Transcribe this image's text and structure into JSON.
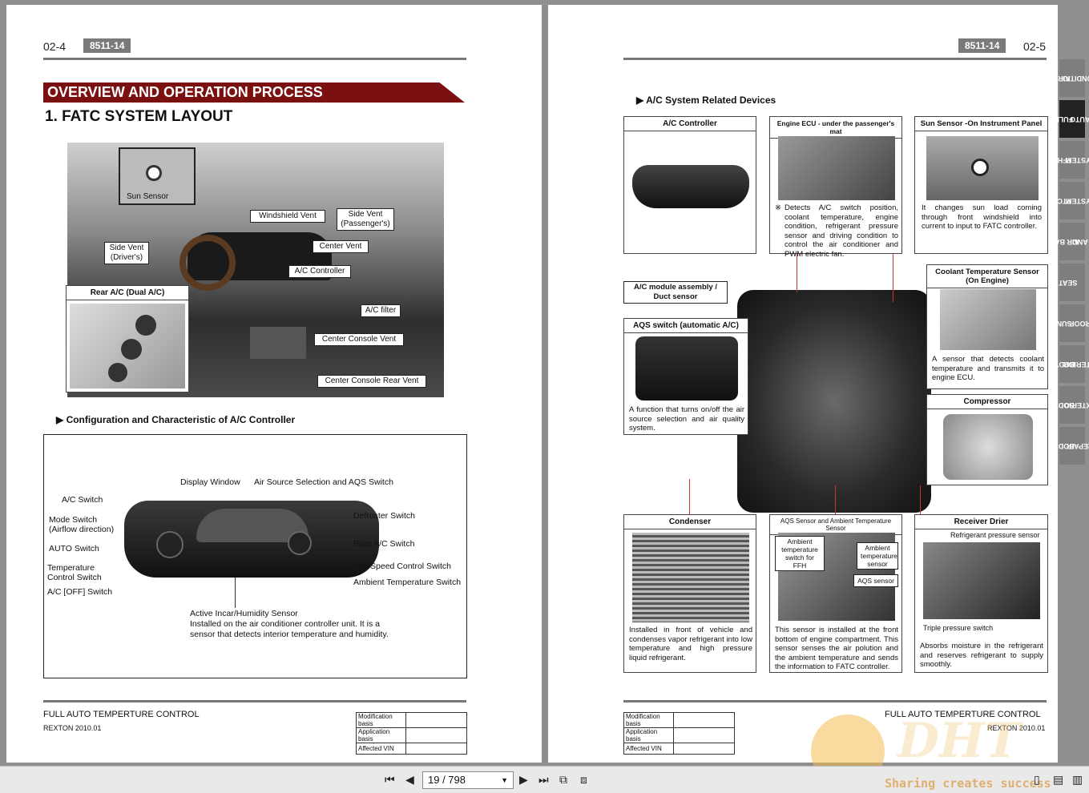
{
  "left": {
    "page_num": "02-4",
    "code": "8511-14",
    "section_title": "OVERVIEW AND OPERATION PROCESS",
    "heading": "1. FATC SYSTEM LAYOUT",
    "layout_callouts": {
      "sun_sensor": "Sun Sensor",
      "windshield_vent": "Windshield Vent",
      "side_vent_passenger_1": "Side Vent",
      "side_vent_passenger_2": "(Passenger's)",
      "side_vent_driver_1": "Side Vent",
      "side_vent_driver_2": "(Driver's)",
      "center_vent": "Center Vent",
      "ac_controller": "A/C Controller",
      "ac_filter": "A/C filter",
      "center_console_vent": "Center Console Vent",
      "center_console_rear_vent": "Center Console Rear Vent",
      "rear_ac": "Rear A/C (Dual A/C)"
    },
    "config_heading": "Configuration and Characteristic of A/C Controller",
    "controller_labels": {
      "display_window": "Display Window",
      "air_source": "Air Source Selection and AQS Switch",
      "ac_switch": "A/C Switch",
      "mode_switch_1": "Mode Switch",
      "mode_switch_2": "(Airflow direction)",
      "auto_switch": "AUTO Switch",
      "temp_1": "Temperature",
      "temp_2": "Control Switch",
      "ac_off": "A/C [OFF] Switch",
      "defroster": "Defroster Switch",
      "rear_ac": "Rear A/C Switch",
      "fan_speed": "Fan Speed Control Switch",
      "ambient_temp": "Ambient Temperature Switch",
      "incar_title": "Active Incar/Humidity Sensor",
      "incar_desc_1": "Installed on the air conditioner controller unit. It is a",
      "incar_desc_2": "sensor that detects interior temperature and humidity."
    },
    "footer_title": "FULL AUTO TEMPERTURE CONTROL",
    "footer_sub": "REXTON 2010.01",
    "footer_table": [
      "Modification basis",
      "Application basis",
      "Affected VIN"
    ]
  },
  "right": {
    "page_num": "02-5",
    "code": "8511-14",
    "devices_heading": "A/C System Related Devices",
    "ac_controller": "A/C Controller",
    "engine_ecu": "Engine ECU - under the passenger's mat",
    "engine_ecu_mark": "※",
    "engine_ecu_desc": "Detects A/C switch position, coolant temperature, engine condition, refrigerant pressure sensor and driving condition to control the air conditioner and PWM electric fan.",
    "sun_sensor": "Sun Sensor -On Instrument Panel",
    "sun_sensor_desc": "It changes sun load coming through front windshield into current to input to FATC controller.",
    "ac_module_1": "A/C module assembly /",
    "ac_module_2": "Duct sensor",
    "coolant_1": "Coolant Temperature Sensor",
    "coolant_2": "(On Engine)",
    "coolant_desc": "A sensor that detects coolant temperature and transmits it to engine ECU.",
    "aqs_switch": "AQS switch (automatic A/C)",
    "aqs_desc": "A function that turns on/off the air source selection and air quality system.",
    "compressor": "Compressor",
    "condenser": "Condenser",
    "condenser_desc": "Installed in front of vehicle and condenses vapor refrigerant into low temperature and high pressure liquid refrigerant.",
    "aqs_sensor": "AQS Sensor and Ambient Temperature Sensor",
    "aqs_sensor_desc": "This sensor is installed at the front bottom of engine compartment. This sensor senses the air polution and the ambient temperature and sends the information to FATC controller.",
    "ambient_ffh_1": "Ambient",
    "ambient_ffh_2": "temperature",
    "ambient_ffh_3": "switch for FFH",
    "ambient_sensor_1": "Ambient",
    "ambient_sensor_2": "temperature",
    "ambient_sensor_3": "sensor",
    "aqs_sensor_lbl": "AQS sensor",
    "receiver": "Receiver Drier",
    "refrig_pressure": "Refrigerant pressure sensor",
    "triple_pressure": "Triple pressure switch",
    "receiver_desc": "Absorbs moisture in the refrigerant and reserves refrigerant to supply smoothly.",
    "footer_title": "FULL AUTO TEMPERTURE CONTROL",
    "footer_sub": "REXTON 2010.01",
    "footer_table": [
      "Modification basis",
      "Application basis",
      "Affected VIN"
    ]
  },
  "tabs": [
    {
      "l1": "AIR",
      "l2": "CONDITIO"
    },
    {
      "l1": "FULL",
      "l2": "AUTO"
    },
    {
      "l1": "FFH",
      "l2": "SYSTEM"
    },
    {
      "l1": "PTC",
      "l2": "SYSTEM"
    },
    {
      "l1": "AIR BAG",
      "l2": "AND"
    },
    {
      "l1": "SEAT",
      "l2": ""
    },
    {
      "l1": "SUN",
      "l2": "ROOF"
    },
    {
      "l1": "BODY",
      "l2": "INTERIOR"
    },
    {
      "l1": "BODY",
      "l2": "EXTERIO"
    },
    {
      "l1": "BODY",
      "l2": "REPAIR"
    }
  ],
  "toolbar": {
    "page_indicator": "19 / 798",
    "watermark_text": "Sharing creates success",
    "watermark_logo": "DHT"
  }
}
